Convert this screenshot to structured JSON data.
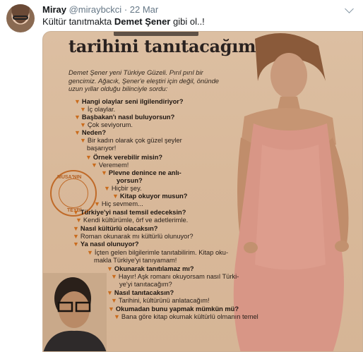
{
  "tweet": {
    "author_name": "Miray",
    "author_handle": "@miraybckci",
    "separator": "·",
    "date": "22 Mar",
    "text_before": "Kültür tanıtmakta ",
    "text_bold": "Demet Şener",
    "text_after": " gibi ol..!"
  },
  "icons": {
    "avatar": "profile-photo",
    "menu": "chevron-down-icon",
    "bullet": "orange-triangle-icon"
  },
  "clipping": {
    "headline": "tarihini tanıtacağım",
    "intro": "Demet Şener yeni Türkiye Güzeli. Pırıl pırıl bir gencimiz. Ağacık, Şener'e eleştiri için değil, önünde uzun yıllar olduğu bilinciyle sordu:",
    "seal_top": "MUSA'NIN",
    "seal_bottom": "TEYBİ",
    "lines": [
      {
        "t": "Hangi olaylar seni ilgilendiriyor?",
        "q": true
      },
      {
        "t": "İç olaylar.",
        "q": false
      },
      {
        "t": "Başbakan'ı nasıl buluyorsun?",
        "q": true
      },
      {
        "t": "Çok seviyorum.",
        "q": false
      },
      {
        "t": "Neden?",
        "q": true
      },
      {
        "t": "Bir kadın olarak çok güzel şeyler",
        "q": false
      },
      {
        "t": "başarıyor!",
        "q": false
      },
      {
        "t": "Örnek verebilir misin?",
        "q": true
      },
      {
        "t": "Veremem!",
        "q": false
      },
      {
        "t": "Plevne denince ne anlı-",
        "q": true
      },
      {
        "t": "yorsun?",
        "q": true
      },
      {
        "t": "Hiçbir şey.",
        "q": false
      },
      {
        "t": "Kitap okuyor musun?",
        "q": true
      },
      {
        "t": "Hiç sevmem...",
        "q": false
      },
      {
        "t": "Türkiye'yi nasıl temsil edeceksin?",
        "q": true
      },
      {
        "t": "Kendi kültürümle, örf ve adetlerimle.",
        "q": false
      },
      {
        "t": "Nasıl kültürlü olacaksın?",
        "q": true
      },
      {
        "t": "Roman okunarak mı kültürlü olunuyor?",
        "q": false
      },
      {
        "t": "Ya nasıl olunuyor?",
        "q": true
      },
      {
        "t": "İçten gelen bilgilerimle tanıtabilirim. Kitap oku-",
        "q": false
      },
      {
        "t": "makla Türkiye'yi tanıyamam!",
        "q": false
      },
      {
        "t": "Okunarak tanıtılamaz mı?",
        "q": true
      },
      {
        "t": "Hayır! Aşk romanı okuyorsam nasıl Türki-",
        "q": false
      },
      {
        "t": "ye'yi tanıtacağım?",
        "q": false
      },
      {
        "t": "Nasıl tanıtacaksın?",
        "q": true
      },
      {
        "t": "Tarihini, kültürünü anlatacağım!",
        "q": false
      },
      {
        "t": "Okumadan bunu yapmak mümkün mü?",
        "q": true
      },
      {
        "t": "Bana göre kitap okumak kültürlü olmanın temel",
        "q": false
      }
    ]
  },
  "colors": {
    "paper": "#dcbfa2",
    "bullet": "#c96b1c",
    "text": "#14171a",
    "muted": "#657786"
  }
}
